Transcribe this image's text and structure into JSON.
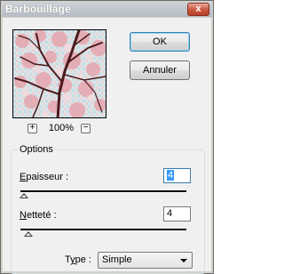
{
  "window": {
    "title": "Barbouillage",
    "close_glyph": "x"
  },
  "preview": {
    "zoom_in_glyph": "+",
    "zoom_out_glyph": "−",
    "zoom_level": "100%"
  },
  "buttons": {
    "ok": "OK",
    "cancel": "Annuler"
  },
  "options": {
    "group_title": "Options",
    "thickness": {
      "label_accel": "E",
      "label_rest": "paisseur :",
      "value": "4",
      "slider_level": 0.02
    },
    "sharpness": {
      "label_accel": "N",
      "label_rest": "etteté :",
      "value": "4",
      "slider_level": 0.05
    },
    "type": {
      "label_prefix": "T",
      "label_accel": "y",
      "label_rest": "pe :",
      "selected": "Simple"
    }
  }
}
